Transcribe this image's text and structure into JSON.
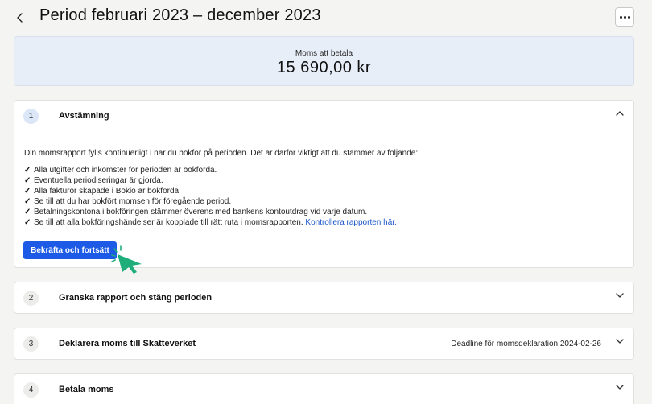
{
  "header": {
    "title": "Period februari 2023 – december 2023"
  },
  "summary": {
    "label": "Moms att betala",
    "amount": "15 690,00 kr"
  },
  "steps": [
    {
      "number": "1",
      "title": "Avstämning",
      "expanded": true,
      "intro": "Din momsrapport fylls kontinuerligt i när du bokför på perioden. Det är därför viktigt att du stämmer av följande:",
      "checklist": [
        "Alla utgifter och inkomster för perioden är bokförda.",
        "Eventuella periodiseringar är gjorda.",
        "Alla fakturor skapade i Bokio är bokförda.",
        "Se till att du har bokfört momsen för föregående period.",
        "Betalningskontona i bokföringen stämmer överens med bankens kontoutdrag vid varje datum.",
        "Se till att alla bokföringshändelser är kopplade till rätt ruta i momsrapporten."
      ],
      "link_text": "Kontrollera rapporten här.",
      "button_label": "Bekräfta och fortsätt"
    },
    {
      "number": "2",
      "title": "Granska rapport och stäng perioden"
    },
    {
      "number": "3",
      "title": "Deklarera moms till Skatteverket",
      "deadline": "Deadline för momsdeklaration 2024-02-26"
    },
    {
      "number": "4",
      "title": "Betala moms"
    }
  ],
  "colors": {
    "accent": "#1d5be6",
    "link": "#1a56c9",
    "cursor": "#1fae7a",
    "summary_bg": "#e8eef8"
  },
  "icons": {
    "back": "chevron-left-icon",
    "more": "more-horizontal-icon",
    "collapse": "chevron-up-icon",
    "expand": "chevron-down-icon",
    "cursor": "click-cursor-icon"
  }
}
